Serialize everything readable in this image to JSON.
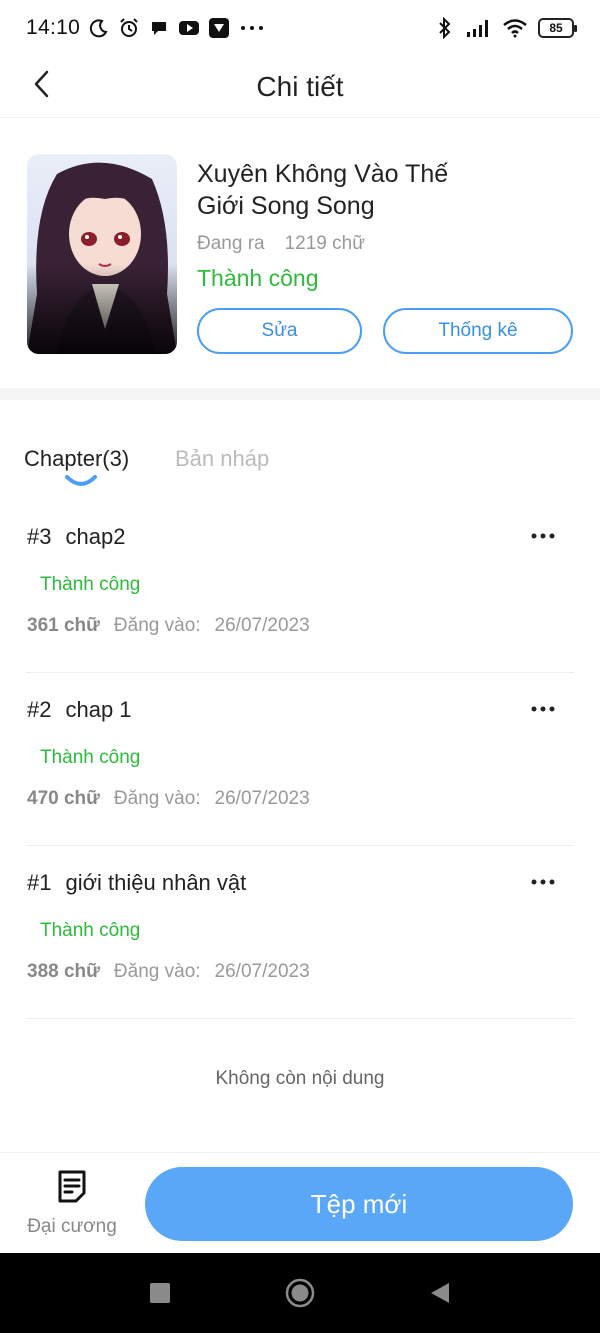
{
  "status_bar": {
    "time": "14:10",
    "battery": "85",
    "left_icons": [
      "moon-icon",
      "alarm-icon",
      "chat-bubble-icon",
      "youtube-icon",
      "media-icon",
      "more-dots-icon"
    ],
    "right_icons": [
      "bluetooth-icon",
      "signal-icon",
      "wifi-icon",
      "battery-icon"
    ]
  },
  "header": {
    "title": "Chi tiết",
    "back_icon": "chevron-left-icon"
  },
  "book": {
    "title": "Xuyên Không Vào Thế Giới Song Song",
    "state": "Đang ra",
    "word_count": "1219 chữ",
    "status": "Thành công",
    "edit_label": "Sửa",
    "stats_label": "Thống kê"
  },
  "tabs": [
    {
      "label": "Chapter(3)",
      "active": true
    },
    {
      "label": "Bản nháp",
      "active": false
    }
  ],
  "chapters": [
    {
      "number": "#3",
      "title": "chap2",
      "status": "Thành công",
      "words": "361 chữ",
      "posted_label": "Đăng vào:",
      "date": "26/07/2023"
    },
    {
      "number": "#2",
      "title": "chap 1",
      "status": "Thành công",
      "words": "470 chữ",
      "posted_label": "Đăng vào:",
      "date": "26/07/2023"
    },
    {
      "number": "#1",
      "title": "giới thiệu nhân vật",
      "status": "Thành công",
      "words": "388 chữ",
      "posted_label": "Đăng vào:",
      "date": "26/07/2023"
    }
  ],
  "end_message": "Không còn nội dung",
  "bottom_bar": {
    "outline_label": "Đại cương",
    "new_file_label": "Tệp mới"
  },
  "colors": {
    "accent": "#5ba7f7",
    "success": "#2dbb3c",
    "muted": "#999999"
  }
}
